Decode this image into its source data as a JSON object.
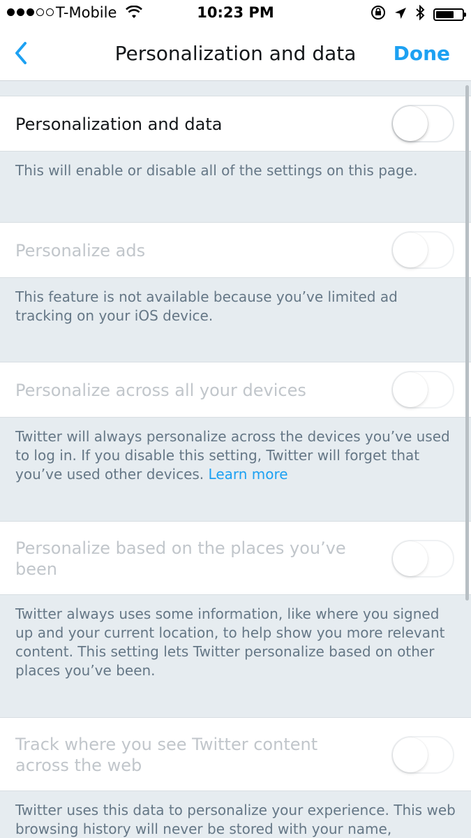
{
  "status_bar": {
    "carrier": "T-Mobile",
    "time": "10:23 PM",
    "battery_level": 0.7
  },
  "nav": {
    "title": "Personalization and data",
    "done_label": "Done"
  },
  "settings": [
    {
      "label": "Personalization and data",
      "enabled": true,
      "on": false,
      "description": "This will enable or disable all of the settings on this page."
    },
    {
      "label": "Personalize ads",
      "enabled": false,
      "on": false,
      "description": "This feature is not available because you’ve limited ad tracking on your iOS device."
    },
    {
      "label": "Personalize across all your devices",
      "enabled": false,
      "on": false,
      "description": "Twitter will always personalize across the devices you’ve used to log in. If you disable this setting, Twitter will forget that you’ve used other devices.",
      "link": "Learn more"
    },
    {
      "label": "Personalize based on the places you’ve been",
      "enabled": false,
      "on": false,
      "description": "Twitter always uses some information, like where you signed up and your current location, to help show you more relevant content. This setting lets Twitter personalize based on other places you’ve been."
    },
    {
      "label": "Track where you see Twitter content across the web",
      "enabled": false,
      "on": false,
      "description": "Twitter uses this data to personalize your experience. This web browsing history will never be stored with your name,"
    }
  ],
  "colors": {
    "accent": "#1da1f2",
    "background": "#e6ecf0",
    "disabled_text": "#c1c6cb",
    "description_text": "#657786"
  },
  "icons": {
    "back": "chevron-left-icon",
    "wifi": "wifi-icon",
    "orientation_lock": "orientation-lock-icon",
    "location": "location-arrow-icon",
    "bluetooth": "bluetooth-icon",
    "battery": "battery-icon"
  }
}
